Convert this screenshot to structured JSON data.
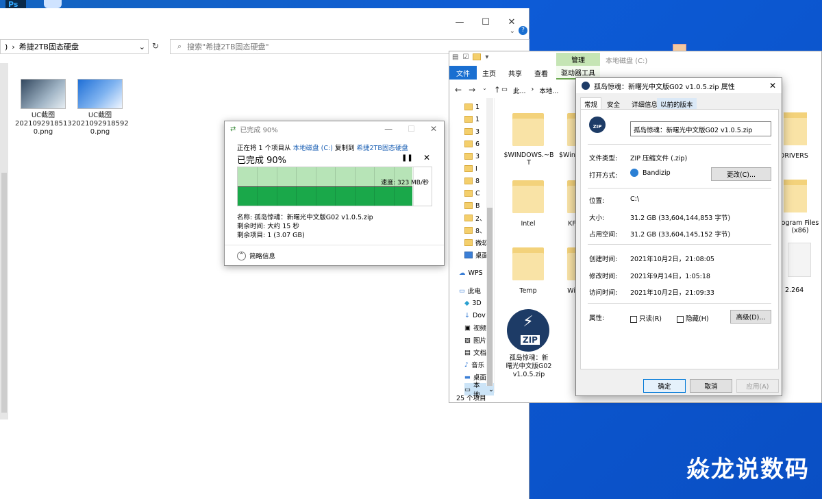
{
  "desktop": {
    "ps_icon_label": "Ps",
    "watermark": "焱龙说数码"
  },
  "left_window": {
    "address_text": "希捷2TB固态硬盘",
    "address_prefix": ")",
    "search_placeholder": "搜索\"希捷2TB固态硬盘\"",
    "files": [
      {
        "name_line1": "UC截图",
        "name_line2": "2021092918513",
        "name_line3": "0.png"
      },
      {
        "name_line1": "UC截图",
        "name_line2": "2021092918592",
        "name_line3": "0.png"
      }
    ]
  },
  "copy_dialog": {
    "title": "已完成 90%",
    "line_prefix": "正在将 1 个项目从",
    "source": "本地磁盘 (C:)",
    "line_mid": "复制到",
    "dest": "希捷2TB固态硬盘",
    "percent_text": "已完成 90%",
    "progress": 0.9,
    "speed": "速度: 323 MB/秒",
    "name_line": "名称: 孤岛惊魂：新曙光中文版G02 v1.0.5.zip",
    "time_line": "剩余时间: 大约 15 秒",
    "items_line": "剩余项目: 1 (3.07 GB)",
    "less_details": "简略信息",
    "pause_icon": "pause-icon",
    "close_icon": "close-icon"
  },
  "right_window": {
    "context_tab": "管理",
    "context_title": "本地磁盘 (C:)",
    "tabs": [
      "文件",
      "主页",
      "共享",
      "查看",
      "驱动器工具"
    ],
    "breadcrumb": [
      "此...",
      "本地..."
    ],
    "nav_items": [
      "1",
      "1",
      "3",
      "6",
      "3",
      "I",
      "8",
      "C",
      "B",
      "2、",
      "8、",
      "微软",
      "桌面",
      "WPS",
      "此电",
      "3D",
      "Dov",
      "视频",
      "图片",
      "文档",
      "音乐",
      "桌面",
      "本地"
    ],
    "folders": [
      {
        "label_line1": "$WINDOWS.~B",
        "label_line2": "T"
      },
      {
        "label_line1": "$Wind",
        "label_line2": ""
      },
      {
        "label_line1": "DRIVERS",
        "label_line2": ""
      },
      {
        "label_line1": "Intel",
        "label_line2": ""
      },
      {
        "label_line1": "KF",
        "label_line2": ""
      },
      {
        "label_line1": "ogram Files",
        "label_line2": "(x86)"
      },
      {
        "label_line1": "Temp",
        "label_line2": ""
      },
      {
        "label_line1": "Wi",
        "label_line2": ""
      },
      {
        "label_line1": "2.264",
        "label_line2": ""
      }
    ],
    "zip_file": {
      "line1": "孤岛惊魂：新",
      "line2": "曙光中文版G02",
      "line3": "v1.0.5.zip",
      "badge": "ZIP"
    },
    "status": "25 个项目"
  },
  "properties": {
    "title": "孤岛惊魂：新曙光中文版G02 v1.0.5.zip 属性",
    "tabs": [
      "常规",
      "安全",
      "详细信息",
      "以前的版本"
    ],
    "filename": "孤岛惊魂：新曙光中文版G02 v1.0.5.zip",
    "type_label": "文件类型:",
    "type_value": "ZIP 压缩文件 (.zip)",
    "open_label": "打开方式:",
    "open_value": "Bandizip",
    "change_button": "更改(C)...",
    "location_label": "位置:",
    "location_value": "C:\\",
    "size_label": "大小:",
    "size_value": "31.2 GB (33,604,144,853 字节)",
    "disk_label": "占用空间:",
    "disk_value": "31.2 GB (33,604,145,152 字节)",
    "created_label": "创建时间:",
    "created_value": "2021年10月2日，21:08:05",
    "modified_label": "修改时间:",
    "modified_value": "2021年9月14日，1:05:18",
    "accessed_label": "访问时间:",
    "accessed_value": "2021年10月2日，21:09:33",
    "attr_label": "属性:",
    "readonly_label": "只读(R)",
    "hidden_label": "隐藏(H)",
    "advanced_button": "高级(D)...",
    "ok_button": "确定",
    "cancel_button": "取消",
    "apply_button": "应用(A)",
    "zip_badge": "ZIP"
  }
}
